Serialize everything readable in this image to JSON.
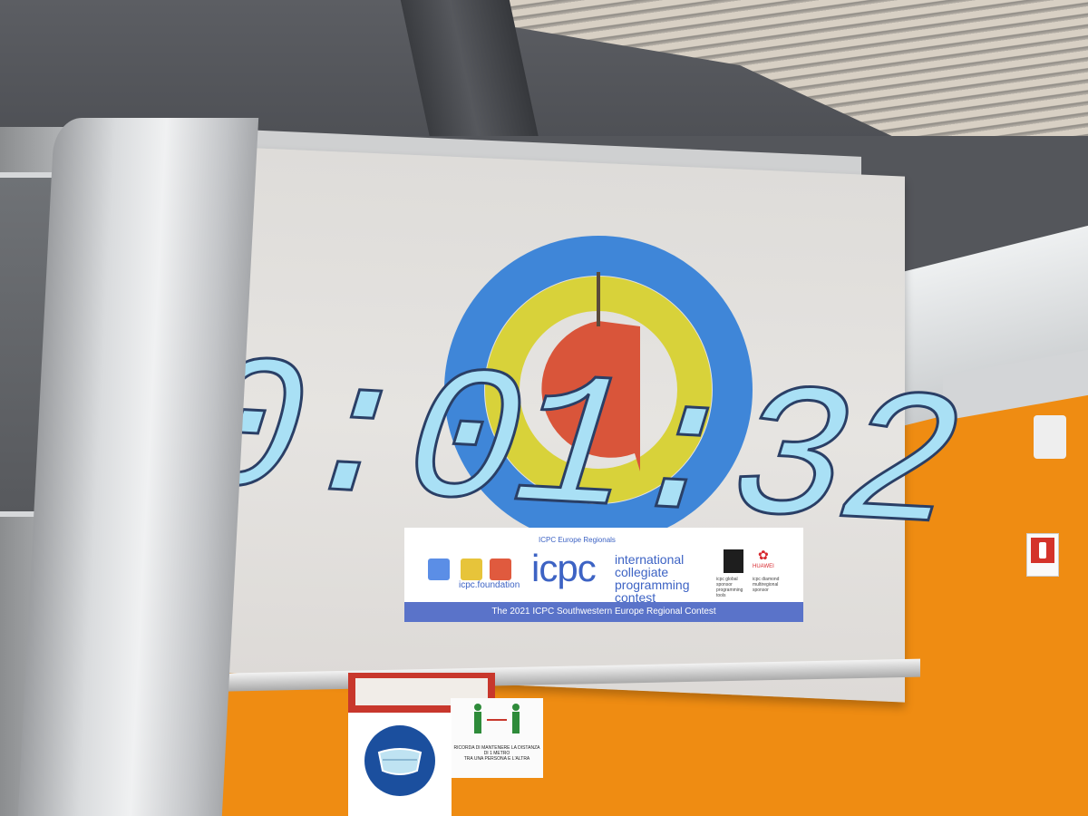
{
  "countdown": {
    "text": "-0:01:32",
    "digit_color": "#a9e0f5",
    "digit_outline": "#2a3f66"
  },
  "banner": {
    "caption": "ICPC Europe Regionals",
    "brand": "icpc",
    "brand_sub": "international collegiate programming contest",
    "foundation": "icpc.foundation",
    "sponsor_one": "icpc global sponsor programming tools",
    "sponsor_two": "icpc diamond multiregional sponsor",
    "sponsor_two_brand": "HUAWEI",
    "footer": "The 2021 ICPC Southwestern Europe Regional Contest"
  },
  "signs": {
    "distance_text_1": "RICORDA DI MANTENERE LA DISTANZA",
    "distance_text_2": "DI 1 METRO",
    "distance_text_3": "TRA UNA PERSONA E L'ALTRA"
  },
  "colors": {
    "wall": "#ef8c12",
    "ring_blue": "#3f86d8",
    "ring_yellow": "#d8d23a",
    "ring_red": "#d9553a",
    "banner_blue": "#3d63c4"
  }
}
